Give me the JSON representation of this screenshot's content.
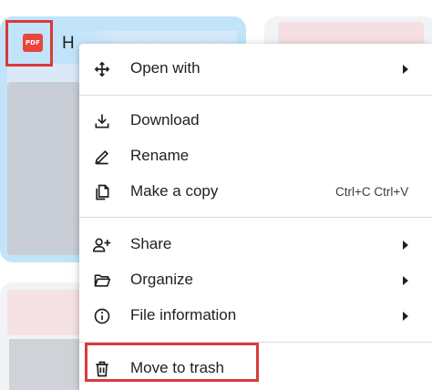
{
  "file": {
    "type_badge": "PDF",
    "name_prefix": "H"
  },
  "menu": {
    "open_with": {
      "label": "Open with",
      "icon": "open-with-move-icon"
    },
    "download": {
      "label": "Download",
      "icon": "download-icon"
    },
    "rename": {
      "label": "Rename",
      "icon": "edit-pencil-icon"
    },
    "make_copy": {
      "label": "Make a copy",
      "icon": "copy-icon",
      "shortcut": "Ctrl+C Ctrl+V"
    },
    "share": {
      "label": "Share",
      "icon": "person-add-icon"
    },
    "organize": {
      "label": "Organize",
      "icon": "folder-open-icon"
    },
    "file_information": {
      "label": "File information",
      "icon": "info-icon"
    },
    "move_to_trash": {
      "label": "Move to trash",
      "icon": "trash-icon"
    }
  },
  "colors": {
    "highlight_box": "#d93b3b",
    "selected_card": "#c2e4fb",
    "pdf_badge": "#e8453c"
  }
}
